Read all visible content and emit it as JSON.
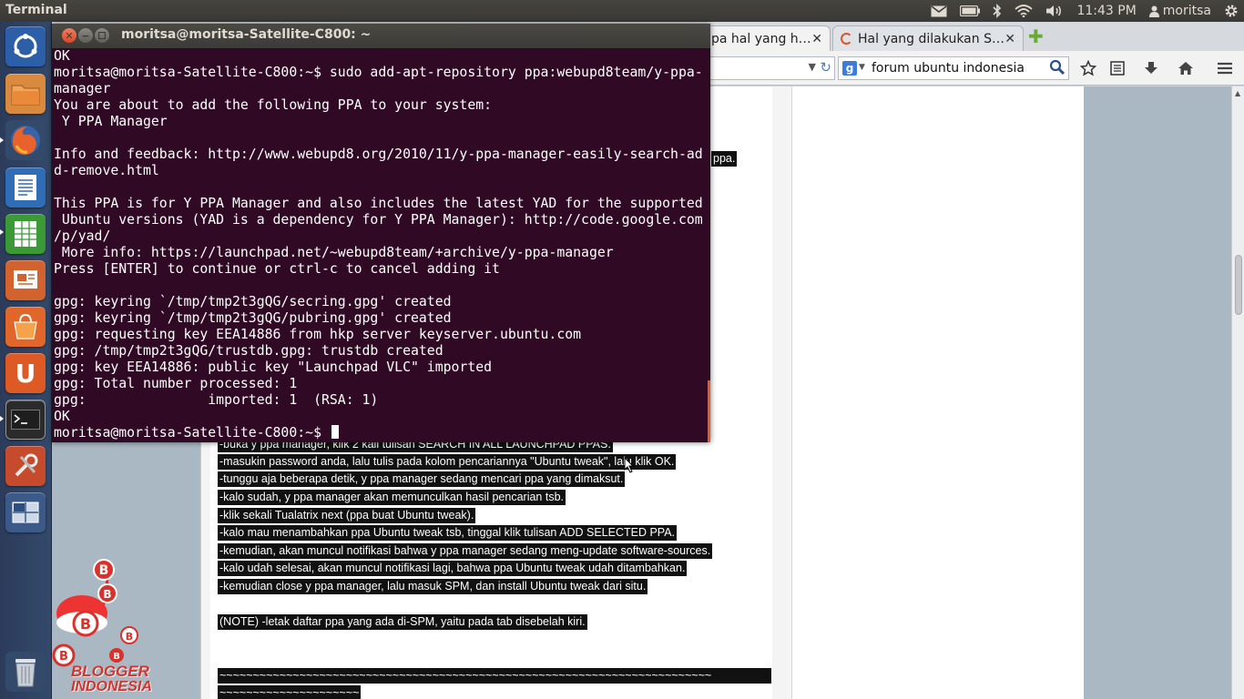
{
  "top_panel": {
    "app_title": "Terminal",
    "clock": "11:43 PM",
    "user": "moritsa",
    "indicators": [
      "mail-icon",
      "battery-icon",
      "bluetooth-icon",
      "wifi-icon",
      "volume-icon"
    ]
  },
  "launcher": {
    "items": [
      {
        "name": "ubuntu-dash",
        "color": "#2a5ba8"
      },
      {
        "name": "files",
        "color": "#e07a3a"
      },
      {
        "name": "firefox",
        "color": "#e8632b"
      },
      {
        "name": "libreoffice-writer",
        "color": "#3b78c0"
      },
      {
        "name": "libreoffice-calc",
        "color": "#3ba03b"
      },
      {
        "name": "libreoffice-impress",
        "color": "#d5673a"
      },
      {
        "name": "software-center",
        "color": "#e56a26"
      },
      {
        "name": "ubuntu-one",
        "color": "#e2632a"
      },
      {
        "name": "terminal",
        "color": "#2e2e2e"
      },
      {
        "name": "system-settings",
        "color": "#c94d2d"
      },
      {
        "name": "workspaces",
        "color": "#3a5a8c"
      },
      {
        "name": "trash",
        "color": "#5b6f8a"
      }
    ]
  },
  "browser": {
    "tabs": [
      {
        "title": "pa hal yang h…",
        "close": "✕"
      },
      {
        "title": "Hal yang dilakukan S…",
        "close": "✕"
      }
    ],
    "new_tab": "✚",
    "search": {
      "engine": "g",
      "value": "forum ubuntu indonesia"
    },
    "post_lines": [
      "ppa.",
      "-buka y ppa manager, klik 2 kali tulisan SEARCH IN ALL LAUNCHPAD PPAS.",
      "-masukin password anda, lalu tulis pada kolom pencariannya \"Ubuntu tweak\", lalu klik OK.",
      "-tunggu aja beberapa detik, y ppa manager sedang mencari ppa yang dimaksut.",
      "-kalo sudah, y ppa manager akan memunculkan hasil pencarian tsb.",
      "-klik sekali Tualatrix next (ppa buat Ubuntu tweak).",
      "-kalo mau menambahkan ppa Ubuntu tweak tsb, tinggal klik tulisan ADD SELECTED PPA.",
      "-kemudian, akan muncul notifikasi bahwa y ppa manager sedang meng-update software-sources.",
      "-kalo udah selesai, akan muncul notifikasi lagi, bahwa ppa Ubuntu tweak udah ditambahkan.",
      "-kemudian close y ppa manager, lalu masuk SPM, dan install Ubuntu tweak dari situ.",
      "(NOTE) -letak daftar ppa yang ada di-SPM, yaitu pada tab disebelah kiri.",
      "~~~~~~~~~~~~~~~~~~~~~~~~~~~~~~~~~~~~~~~~~~~~~~~~~~~~~~~~~~~~~~~~~~~~~~~~~~",
      "~~~~~~~~~~~~~~~~~~~~~"
    ]
  },
  "terminal": {
    "title": "moritsa@moritsa-Satellite-C800: ~",
    "lines": [
      "OK",
      "moritsa@moritsa-Satellite-C800:~$ sudo add-apt-repository ppa:webupd8team/y-ppa-",
      "manager",
      "You are about to add the following PPA to your system:",
      " Y PPA Manager",
      "",
      "Info and feedback: http://www.webupd8.org/2010/11/y-ppa-manager-easily-search-ad",
      "d-remove.html",
      "",
      "This PPA is for Y PPA Manager and also includes the latest YAD for the supported",
      " Ubuntu versions (YAD is a dependency for Y PPA Manager): http://code.google.com",
      "/p/yad/",
      " More info: https://launchpad.net/~webupd8team/+archive/y-ppa-manager",
      "Press [ENTER] to continue or ctrl-c to cancel adding it",
      "",
      "gpg: keyring `/tmp/tmp2t3gQG/secring.gpg' created",
      "gpg: keyring `/tmp/tmp2t3gQG/pubring.gpg' created",
      "gpg: requesting key EEA14886 from hkp server keyserver.ubuntu.com",
      "gpg: /tmp/tmp2t3gQG/trustdb.gpg: trustdb created",
      "gpg: key EEA14886: public key \"Launchpad VLC\" imported",
      "gpg: Total number processed: 1",
      "gpg:               imported: 1  (RSA: 1)",
      "OK"
    ],
    "prompt": "moritsa@moritsa-Satellite-C800:~$ "
  },
  "desktop": {
    "logo_text_1": "BLOGGER",
    "logo_text_2": "INDONESIA"
  }
}
